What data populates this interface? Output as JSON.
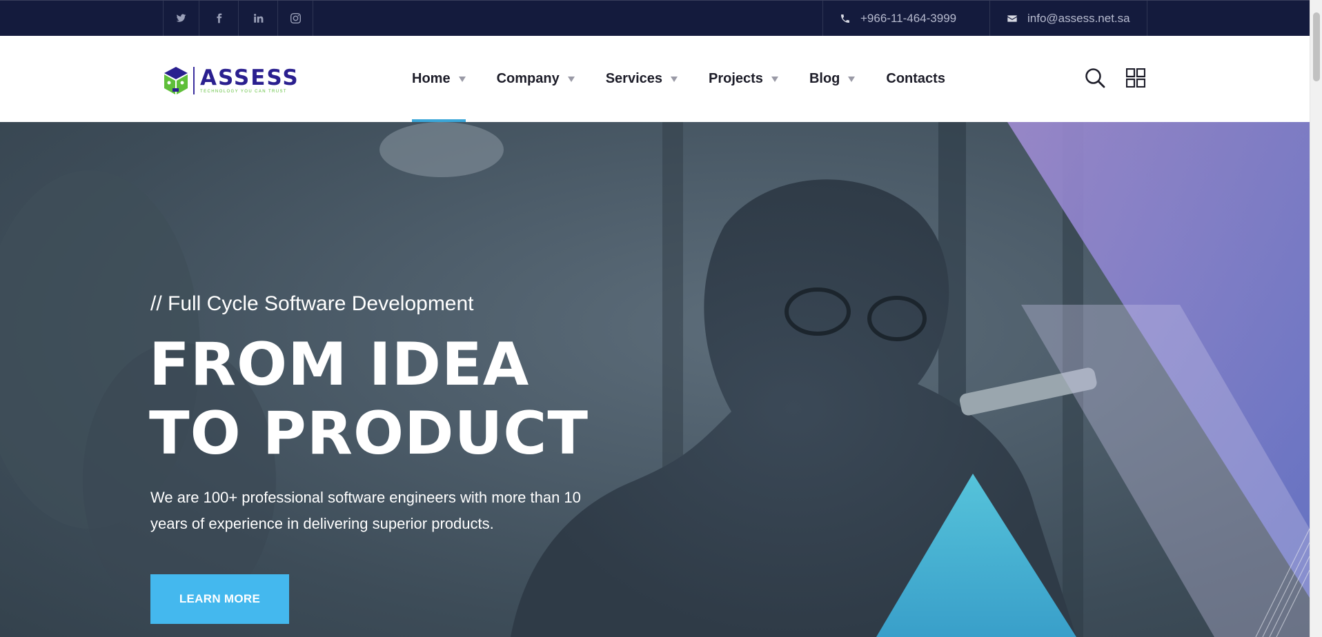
{
  "topbar": {
    "social": [
      {
        "icon": "twitter-icon"
      },
      {
        "icon": "facebook-icon"
      },
      {
        "icon": "linkedin-icon"
      },
      {
        "icon": "instagram-icon"
      }
    ],
    "phone": "+966-11-464-3999",
    "email": "info@assess.net.sa",
    "background": "#141b3d"
  },
  "logo": {
    "word": "ASSESS",
    "tagline": "TECHNOLOGY YOU CAN TRUST"
  },
  "nav": {
    "items": [
      {
        "label": "Home",
        "dropdown": true,
        "active": true
      },
      {
        "label": "Company",
        "dropdown": true,
        "active": false
      },
      {
        "label": "Services",
        "dropdown": true,
        "active": false
      },
      {
        "label": "Projects",
        "dropdown": true,
        "active": false
      },
      {
        "label": "Blog",
        "dropdown": true,
        "active": false
      },
      {
        "label": "Contacts",
        "dropdown": false,
        "active": false
      }
    ],
    "icons": [
      "search-icon",
      "grid-menu-icon"
    ],
    "active_color": "#3aa6d8"
  },
  "hero": {
    "subtitle": "// Full Cycle Software Development",
    "title_line1": "FROM IDEA",
    "title_line2": "TO PRODUCT",
    "description": "We are 100+ professional software engineers with more than 10 years of experience in delivering superior products.",
    "button_label": "LEARN MORE",
    "button_color": "#44b8ee"
  }
}
